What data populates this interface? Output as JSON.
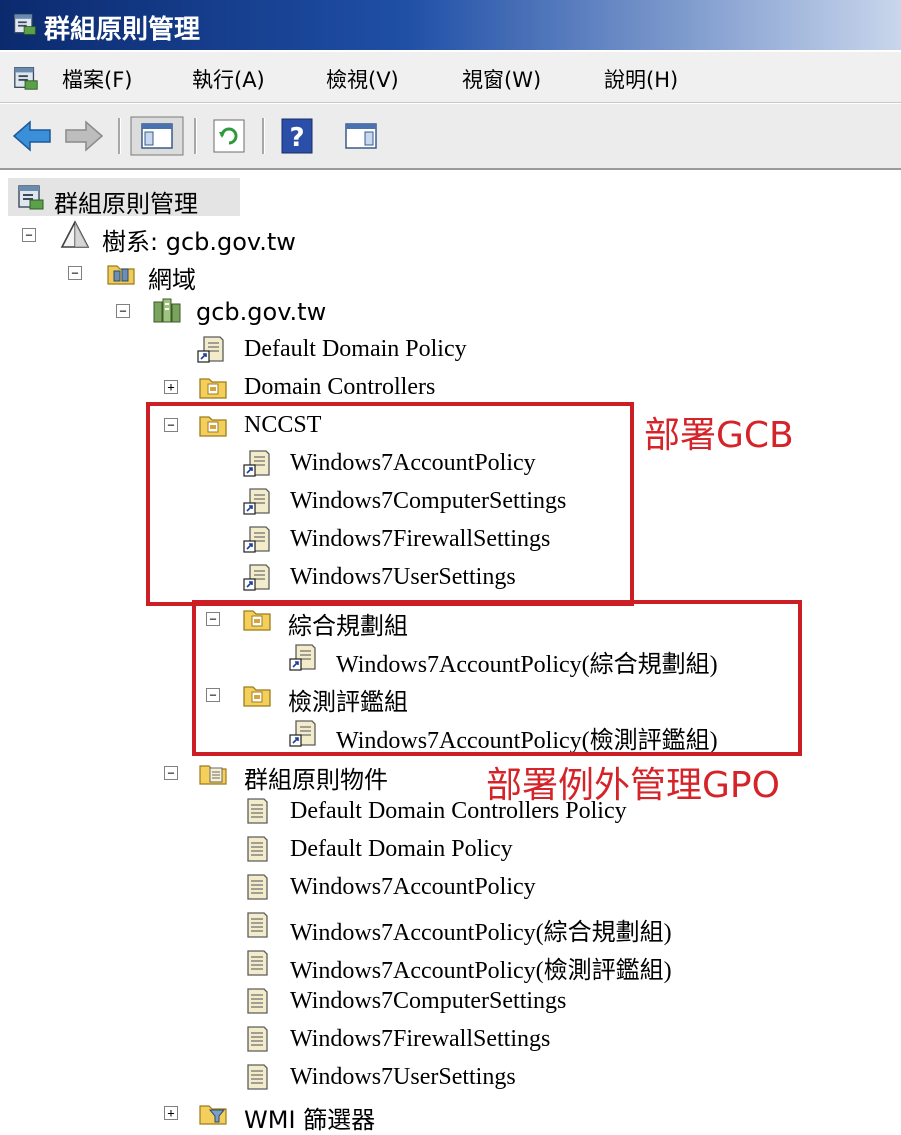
{
  "window": {
    "title": "群組原則管理"
  },
  "menu": [
    "檔案(F)",
    "執行(A)",
    "檢視(V)",
    "視窗(W)",
    "說明(H)"
  ],
  "toolbar": [
    "back-arrow-icon",
    "forward-arrow-icon",
    "show-hide-console-tree-icon",
    "refresh-icon",
    "help-icon",
    "show-hide-action-pane-icon"
  ],
  "tree": {
    "root": "群組原則管理",
    "forest": "樹系: gcb.gov.tw",
    "domains": "網域",
    "domain": "gcb.gov.tw",
    "ddp_link": "Default Domain Policy",
    "dc_ou": "Domain Controllers",
    "nccst_ou": "NCCST",
    "nccst_links": [
      "Windows7AccountPolicy",
      "Windows7ComputerSettings",
      "Windows7FirewallSettings",
      "Windows7UserSettings"
    ],
    "ou_planning": "綜合規劃組",
    "planning_link": "Windows7AccountPolicy(綜合規劃組)",
    "ou_testing": "檢測評鑑組",
    "testing_link": "Windows7AccountPolicy(檢測評鑑組)",
    "gpo_container": "群組原則物件",
    "gpos": [
      "Default Domain Controllers Policy",
      "Default Domain Policy",
      "Windows7AccountPolicy",
      "Windows7AccountPolicy(綜合規劃組)",
      "Windows7AccountPolicy(檢測評鑑組)",
      "Windows7ComputerSettings",
      "Windows7FirewallSettings",
      "Windows7UserSettings"
    ],
    "wmi": "WMI 篩選器"
  },
  "annotations": {
    "deploy_gcb": "部署GCB",
    "deploy_exception": "部署例外管理GPO"
  },
  "colors": {
    "annotation_red": "#cc1f25",
    "title_blue": "#0b2a6e"
  }
}
